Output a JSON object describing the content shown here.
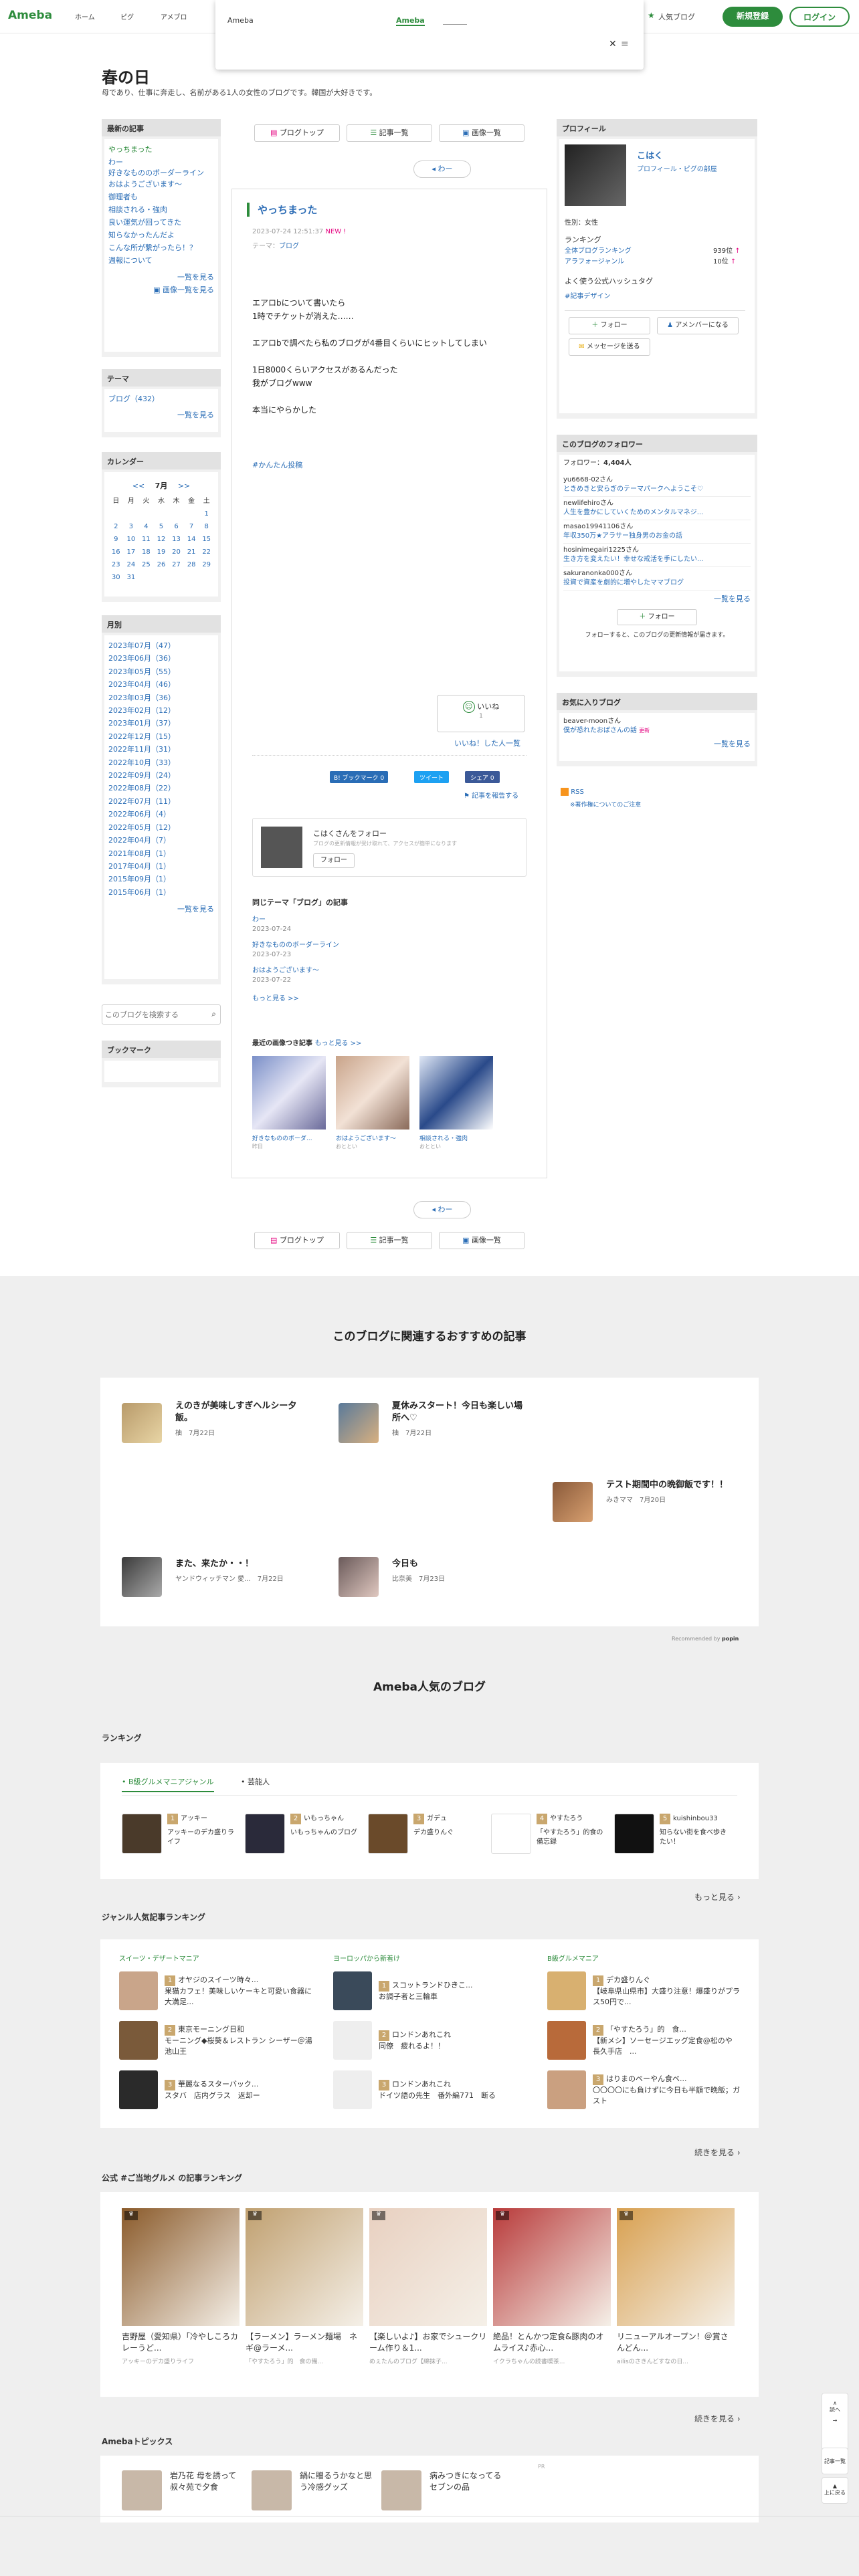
{
  "header": {
    "logo": "Ameba",
    "nav": [
      "ホーム",
      "ピグ",
      "アメブロ"
    ],
    "popular": "人気ブログ",
    "signup": "新規登録",
    "login": "ログイン"
  },
  "dropdown": {
    "left": "Ameba",
    "mid": "Ameba"
  },
  "blog": {
    "title": "春の日",
    "desc": "母であり、仕事に奔走し、名前がある1人の女性のブログです。韓国が大好きです。"
  },
  "sidebar": {
    "recent_h": "最新の記事",
    "recent": [
      "やっちまった",
      "わー",
      "好きなもののボーダーライン",
      "おはようございます〜",
      "御理者も",
      "相談される・強肉",
      "良い運気が回ってきた",
      "知らなかったんだよ",
      "こんな所が繋がったら！？",
      "週報について"
    ],
    "recent_more": "一覧を見る",
    "recent_img": "画像一覧を見る",
    "theme_h": "テーマ",
    "themes": [
      "ブログ（432）"
    ],
    "theme_more": "一覧を見る",
    "cal_h": "カレンダー",
    "cal_month": "7月",
    "cal_prev": "<<",
    "cal_next": ">>",
    "cal_days": [
      "日",
      "月",
      "火",
      "水",
      "木",
      "金",
      "土"
    ],
    "cal_rows": [
      [
        "",
        "",
        "",
        "",
        "",
        "",
        "1"
      ],
      [
        "2",
        "3",
        "4",
        "5",
        "6",
        "7",
        "8"
      ],
      [
        "9",
        "10",
        "11",
        "12",
        "13",
        "14",
        "15"
      ],
      [
        "16",
        "17",
        "18",
        "19",
        "20",
        "21",
        "22"
      ],
      [
        "23",
        "24",
        "25",
        "26",
        "27",
        "28",
        "29"
      ],
      [
        "30",
        "31",
        "",
        "",
        "",
        "",
        ""
      ]
    ],
    "month_h": "月別",
    "months": [
      "2023年07月（47）",
      "2023年06月（36）",
      "2023年05月（55）",
      "2023年04月（46）",
      "2023年03月（36）",
      "2023年02月（12）",
      "2023年01月（37）",
      "2022年12月（15）",
      "2022年11月（31）",
      "2022年10月（33）",
      "2022年09月（24）",
      "2022年08月（22）",
      "2022年07月（11）",
      "2022年06月（4）",
      "2022年05月（12）",
      "2022年04月（7）",
      "2021年08月（1）",
      "2017年04月（1）",
      "2015年09月（1）",
      "2015年06月（1）"
    ],
    "month_more": "一覧を見る",
    "search_ph": "このブログを検索する",
    "bookmark_h": "ブックマーク"
  },
  "tabs": {
    "top": "ブログトップ",
    "list": "記事一覧",
    "images": "画像一覧",
    "nav_label": "わー"
  },
  "article": {
    "title": "やっちまった",
    "date": "2023-07-24 12:51:37",
    "new": "NEW !",
    "theme_label": "テーマ：",
    "theme": "ブログ",
    "body": [
      "エアロbについて書いたら",
      "1時でチケットが消えた……",
      "",
      "エアロbで調べたら私のブログが4番目くらいにヒットしてしまい",
      "",
      "1日8000くらいアクセスがあるんだった",
      "我がブログwww",
      "",
      "本当にやらかした"
    ],
    "hashtag": "#かんたん投稿",
    "like": "いいね",
    "like_count": "1",
    "like_list": "いいね！した人一覧",
    "share1": "B! ブックマーク",
    "share1_count": "0",
    "share2": "ツイート",
    "share3": "シェア",
    "share3_count": "0",
    "report": "記事を報告する",
    "follow_name": "こはくさんをフォロー",
    "follow_desc": "ブログの更新情報が受け取れて、アクセスが簡単になります",
    "follow_btn": "フォロー",
    "same_theme_h": "同じテーマ「ブログ」の記事",
    "same": [
      {
        "t": "わー",
        "d": "2023-07-24"
      },
      {
        "t": "好きなもののボーダーライン",
        "d": "2023-07-23"
      },
      {
        "t": "おはようございます〜",
        "d": "2023-07-22"
      }
    ],
    "same_more": "もっと見る >>",
    "img_h": "最近の画像つき記事",
    "img_more": "もっと見る >>",
    "imgs": [
      {
        "t": "好きなもののボーダ...",
        "d": "昨日"
      },
      {
        "t": "おはようございます〜",
        "d": "おととい"
      },
      {
        "t": "相談される・強肉",
        "d": "おととい"
      }
    ]
  },
  "profile": {
    "h": "プロフィール",
    "name": "こはく",
    "room": "プロフィール・ピグの部屋",
    "sex": "性別：女性",
    "ranking_h": "ランキング",
    "r1": "全体ブログランキング",
    "r1v": "939位",
    "r2": "アラフォージャンル",
    "r2v": "10位",
    "hashtag_h": "よく使う公式ハッシュタグ",
    "hashtag": "#記事デザイン",
    "follow": "フォロー",
    "amember": "アメンバーになる",
    "message": "メッセージを送る"
  },
  "followers": {
    "h": "このブログのフォロワー",
    "count_label": "フォロワー：",
    "count": "4,404人",
    "list": [
      {
        "n": "yu6668-02さん",
        "t": "ときめきと安らぎのテーマパークへようこそ♡"
      },
      {
        "n": "newlifehiroさん",
        "t": "人生を豊かにしていくためのメンタルマネジ..."
      },
      {
        "n": "masao19941106さん",
        "t": "年収350万★アラサー独身男のお金の話"
      },
      {
        "n": "hosinimegairi1225さん",
        "t": "生き方を変えたい！幸せな戒活を手にしたい..."
      },
      {
        "n": "sakuranonka000さん",
        "t": "投資で資産を劇的に増やしたママブログ"
      }
    ],
    "more": "一覧を見る",
    "btn": "フォロー",
    "note": "フォローすると、このブログの更新情報が届きます。"
  },
  "fav": {
    "h": "お気に入りブログ",
    "n": "beaver-moonさん",
    "t": "僕が恐れたおばさんの話",
    "badge": "更新",
    "more": "一覧を見る",
    "rss": "RSS",
    "rss_note": "※著作権についてのご注意"
  },
  "recommend": {
    "h": "このブログに関連するおすすめの記事",
    "items": [
      {
        "t": "えのきが美味しすぎヘルシー夕飯。",
        "u": "柚",
        "d": "7月22日"
      },
      {
        "t": "夏休みスタート！今日も楽しい場所へ♡",
        "u": "柚",
        "d": "7月22日"
      },
      {
        "t": "テスト期間中の晩御飯です！！",
        "u": "みきママ",
        "d": "7月20日"
      },
      {
        "t": "また、来たか・・！",
        "u": "ヤンドウィッチマン 愛...",
        "d": "7月22日"
      },
      {
        "t": "今日も",
        "u": "比奈美",
        "d": "7月23日"
      }
    ],
    "powered": "Recommended by"
  },
  "popular": {
    "h": "Ameba人気のブログ",
    "rank_h": "ランキング",
    "tabs": [
      "B級グルメマニアジャンル",
      "芸能人"
    ],
    "rank": [
      {
        "n": "1",
        "u": "アッキー",
        "t": "アッキーのデカ盛りライフ"
      },
      {
        "n": "2",
        "u": "いもっちゃん",
        "t": "いもっちゃんのブログ"
      },
      {
        "n": "3",
        "u": "ガデュ",
        "t": "デカ盛りんぐ"
      },
      {
        "n": "4",
        "u": "やすたろう",
        "t": "「やすたろう」的食の備忘録"
      },
      {
        "n": "5",
        "u": "kuishinbou33",
        "t": "知らない街を食べ歩きたい！"
      }
    ],
    "more": "もっと見る"
  },
  "genre": {
    "h": "ジャンル人気記事ランキング",
    "cols": [
      {
        "name": "スイーツ・デザートマニア",
        "items": [
          {
            "n": "1",
            "t": "オヤジのスイーツ時々...",
            "s": "果猫カフェ！美味しいケーキと可愛い食器に大満足..."
          },
          {
            "n": "2",
            "t": "東京モーニング日和",
            "s": "モーニング◆桜葵＆レストラン シーザー＠湯池山王"
          },
          {
            "n": "3",
            "t": "華麗なるスターバック...",
            "s": "スタバ　店内グラス　返却ー"
          }
        ]
      },
      {
        "name": "ヨーロッパから新着け",
        "items": [
          {
            "n": "1",
            "t": "スコットランドひきこ...",
            "s": "お調子者と三輪車"
          },
          {
            "n": "2",
            "t": "ロンドンあれこれ",
            "s": "同僚　疲れるよ！！"
          },
          {
            "n": "3",
            "t": "ロンドンあれこれ",
            "s": "ドイツ語の先生　番外編771　断る"
          }
        ]
      },
      {
        "name": "B級グルメマニア",
        "items": [
          {
            "n": "1",
            "t": "デカ盛りんぐ",
            "s": "【岐阜県山県市】大盛り注意！爆盛りがプラス50円で..."
          },
          {
            "n": "2",
            "t": "「やすたろう」的　食...",
            "s": "【新メシ】ソーセージエッグ定食@松のや　長久手店　..."
          },
          {
            "n": "3",
            "t": "はりまのベーやん食ベ...",
            "s": "〇〇〇〇にも負けずに今日も半額で晩飯；ガスト"
          }
        ]
      }
    ],
    "more": "続きを見る"
  },
  "gourmet": {
    "h": "公式 #ご当地グルメ の記事ランキング",
    "items": [
      {
        "t": "吉野屋（愛知県）「冷やしころカレーうど...",
        "u": "アッキーのデカ盛りライフ"
      },
      {
        "t": "【ラーメン】ラーメン麺場　ネギ@ラーメ...",
        "u": "「やすたろう」的　食の備..."
      },
      {
        "t": "【楽しいよ♪】お家でシュークリーム作り＆1...",
        "u": "めぇたんのブログ【綿抹子..."
      },
      {
        "t": "絶品！とんかつ定食&豚肉のオムライス♪赤心...",
        "u": "イクラちゃんの読書喫茶..."
      },
      {
        "t": "リニューアルオープン！＠賞さんどん...",
        "u": "ailisのさきんどすなの日..."
      }
    ],
    "more": "続きを見る"
  },
  "topics": {
    "h": "Amebaトピックス",
    "pr": "PR",
    "items": [
      {
        "t": "岩乃花 母を誘って叔々苑で夕食"
      },
      {
        "t": "鍋に贈るうかなと思う冷感グッズ"
      },
      {
        "t": "病みつきになってるセブンの品"
      }
    ]
  },
  "float": {
    "top": "読へ",
    "next": "→",
    "list": "記事一覧",
    "up": "上に戻る"
  },
  "colors": {
    "green": "#2d8c3c",
    "link": "#2a6db6",
    "pink": "#e4007f"
  }
}
